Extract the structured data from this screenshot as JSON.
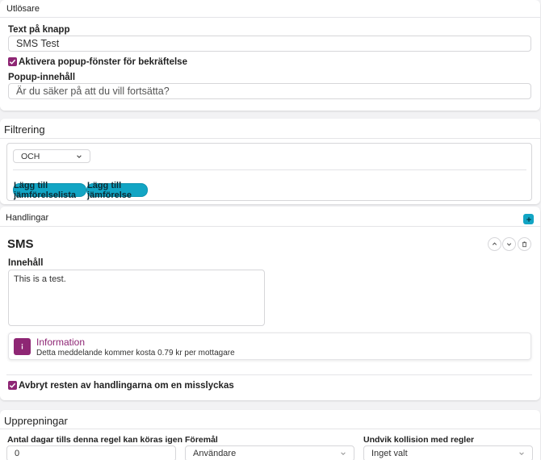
{
  "trigger": {
    "section_title": "Utlösare",
    "button_text_label": "Text på knapp",
    "button_text_value": "SMS Test",
    "popup_checkbox_label": "Aktivera popup-fönster för bekräftelse",
    "popup_content_label": "Popup-innehåll",
    "popup_content_placeholder": "Är du säker på att du vill fortsätta?"
  },
  "filter": {
    "section_title": "Filtrering",
    "operator_value": "OCH",
    "add_list_button": "Lägg till jämförelselista",
    "add_comparison_button": "Lägg till jämförelse"
  },
  "actions": {
    "section_title": "Handlingar",
    "add_icon": "plus-icon",
    "sms": {
      "title": "SMS",
      "content_label": "Innehåll",
      "content_value": "This is a test.",
      "info_title": "Information",
      "info_text": "Detta meddelande kommer kosta 0.79 kr per mottagare",
      "abort_checkbox_label": "Avbryt resten av handlingarna om en misslyckas"
    }
  },
  "repeat": {
    "section_title": "Upprepningar",
    "days_label": "Antal dagar tills denna regel kan köras igen",
    "days_value": "0",
    "object_label": "Föremål",
    "object_value": "Användare",
    "collision_label": "Undvik kollision med regler",
    "collision_value": "Inget valt"
  },
  "colors": {
    "accent_purple": "#8e2674",
    "accent_teal": "#12a5c4"
  }
}
